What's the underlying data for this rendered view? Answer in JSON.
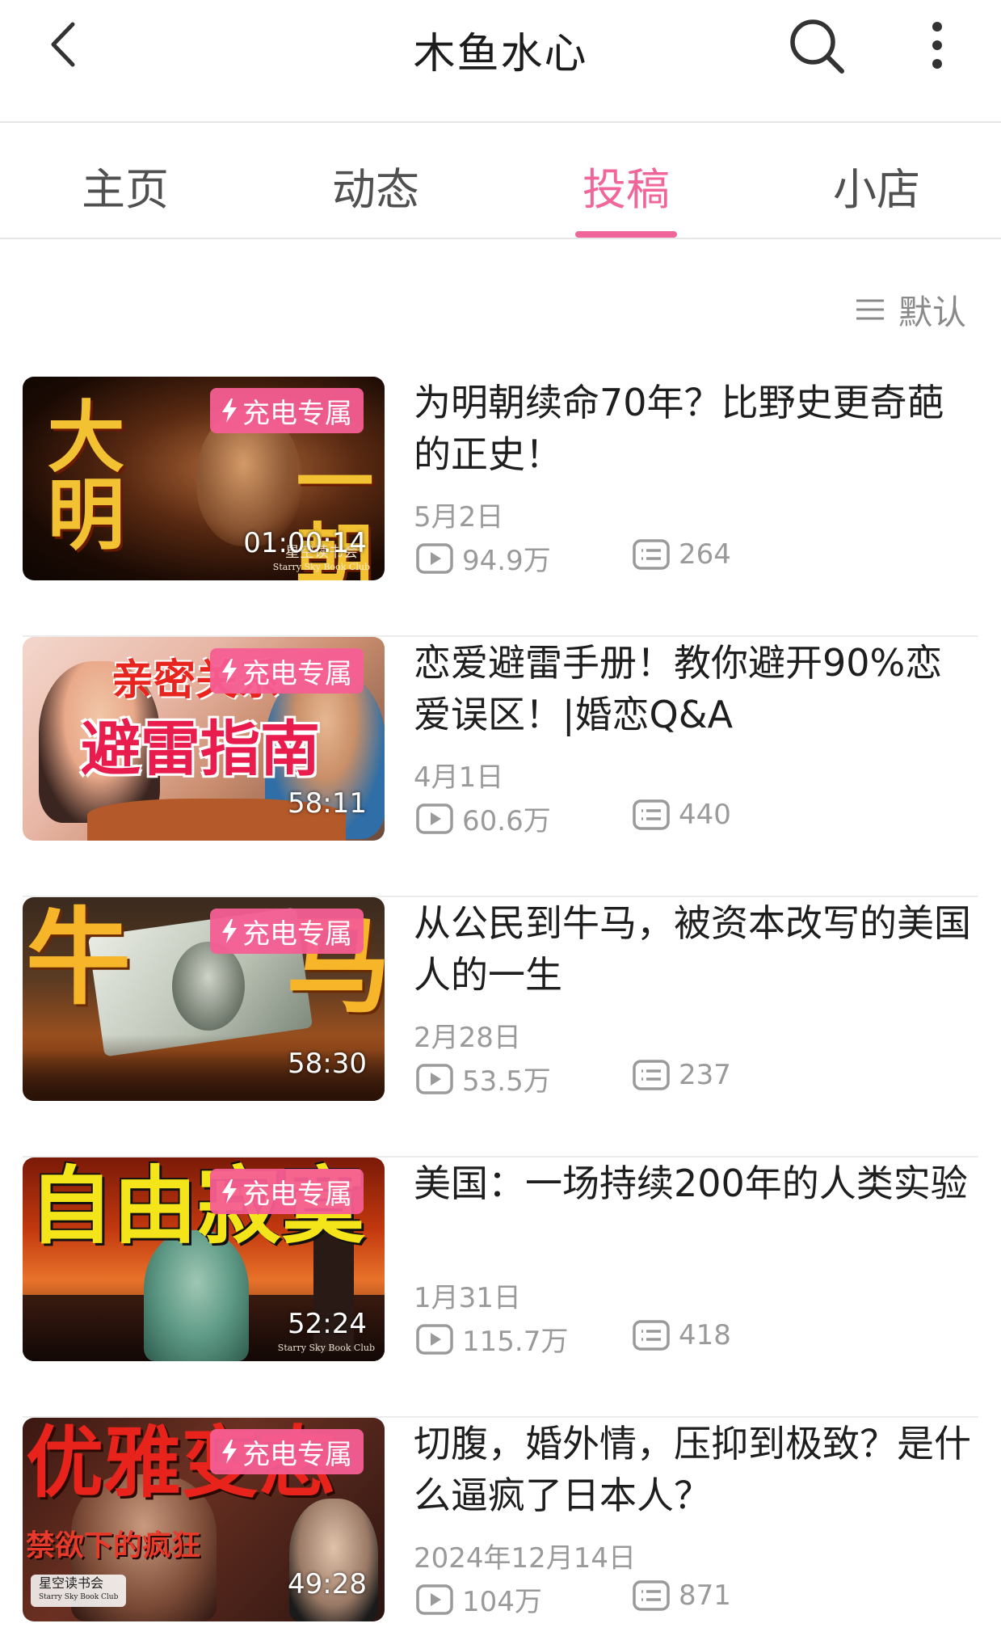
{
  "header": {
    "title": "木鱼水心"
  },
  "tabs": [
    {
      "label": "主页",
      "active": false
    },
    {
      "label": "动态",
      "active": false
    },
    {
      "label": "投稿",
      "active": true
    },
    {
      "label": "小店",
      "active": false
    }
  ],
  "sort": {
    "label": "默认"
  },
  "colors": {
    "accent": "#f0669a",
    "text": "#1e1e1e",
    "muted": "#9a9a9a"
  },
  "videos": [
    {
      "thumb_text": [
        "大明",
        "一朝"
      ],
      "thumb_watermark": "星空读书会",
      "thumb_watermark_en": "Starry Sky Book Club",
      "badge": "充电专属",
      "duration": "01:00:14",
      "title": "为明朝续命70年？比野史更奇葩的正史！",
      "date": "5月2日",
      "views": "94.9万",
      "comments": "264"
    },
    {
      "thumb_text": [
        "亲密关系",
        "避雷指南"
      ],
      "badge": "充电专属",
      "duration": "58:11",
      "title": "恋爱避雷手册！教你避开90%恋爱误区！|婚恋Q&A",
      "date": "4月1日",
      "views": "60.6万",
      "comments": "440"
    },
    {
      "thumb_text": [
        "牛",
        "马"
      ],
      "badge": "充电专属",
      "duration": "58:30",
      "title": "从公民到牛马，被资本改写的美国人的一生",
      "date": "2月28日",
      "views": "53.5万",
      "comments": "237"
    },
    {
      "thumb_text": [
        "自由寂寞"
      ],
      "thumb_watermark_en": "Starry Sky Book Club",
      "badge": "充电专属",
      "duration": "52:24",
      "title": "美国：一场持续200年的人类实验",
      "date": "1月31日",
      "views": "115.7万",
      "comments": "418"
    },
    {
      "thumb_text": [
        "优雅变态",
        "禁欲下的疯狂"
      ],
      "thumb_watermark": "星空读书会",
      "thumb_watermark_en": "Starry Sky Book Club",
      "badge": "充电专属",
      "duration": "49:28",
      "title": "切腹，婚外情，压抑到极致？是什么逼疯了日本人？",
      "date": "2024年12月14日",
      "views": "104万",
      "comments": "871"
    }
  ]
}
